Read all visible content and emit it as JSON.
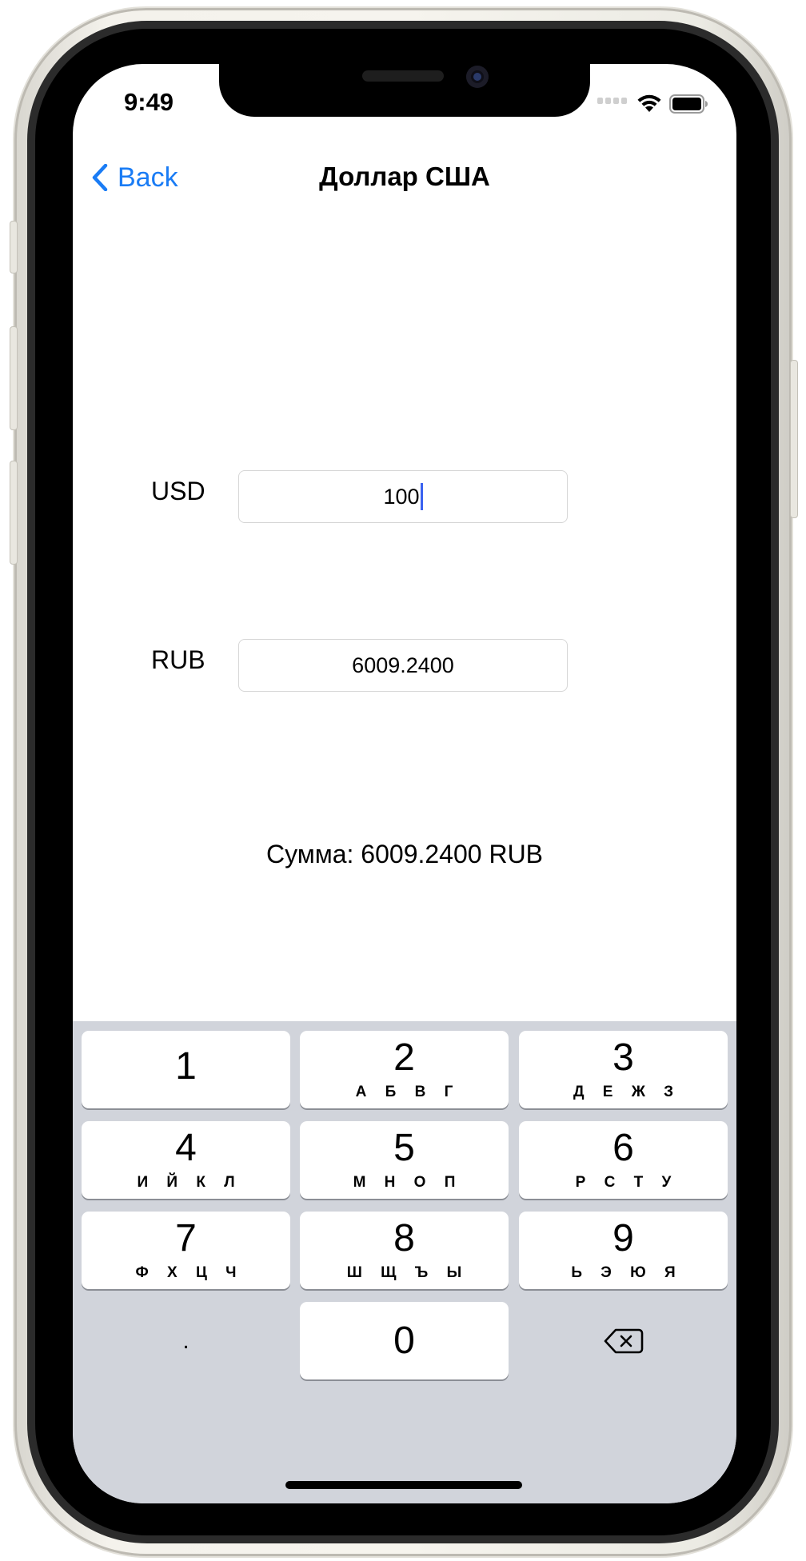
{
  "status_bar": {
    "time": "9:49"
  },
  "nav": {
    "back_label": "Back",
    "title": "Доллар США"
  },
  "form": {
    "usd_label": "USD",
    "usd_value": "100",
    "rub_label": "RUB",
    "rub_value": "6009.2400",
    "sum_text": "Сумма: 6009.2400 RUB"
  },
  "keyboard": {
    "keys": [
      {
        "num": "1",
        "letters": ""
      },
      {
        "num": "2",
        "letters": "А Б В Г"
      },
      {
        "num": "3",
        "letters": "Д Е Ж З"
      },
      {
        "num": "4",
        "letters": "И Й К Л"
      },
      {
        "num": "5",
        "letters": "М Н О П"
      },
      {
        "num": "6",
        "letters": "Р С Т У"
      },
      {
        "num": "7",
        "letters": "Ф Х Ц Ч"
      },
      {
        "num": "8",
        "letters": "Ш Щ Ъ Ы"
      },
      {
        "num": "9",
        "letters": "Ь Э Ю Я"
      }
    ],
    "decimal": ".",
    "zero": "0",
    "delete_icon": "delete-backspace-icon"
  },
  "colors": {
    "accent": "#1a7cf5",
    "keyboard_bg": "#d1d4db",
    "caret": "#3a62f0"
  }
}
